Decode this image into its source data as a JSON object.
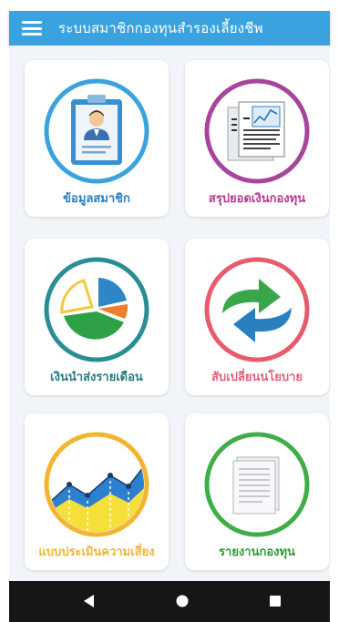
{
  "app": {
    "title": "ระบบสมาชิกกองทุนสำรองเลี้ยงชีพ",
    "accent": "#3aa3df",
    "background": "#f1f4f8"
  },
  "menu": [
    {
      "label": "ข้อมูลสมาชิก",
      "icon": "member-info-icon",
      "color": "#2b7fc4",
      "ring": "#3aa3df"
    },
    {
      "label": "สรุปยอดเงินกองทุน",
      "icon": "fund-summary-icon",
      "color": "#b53a8e",
      "ring": "#a8459a"
    },
    {
      "label": "เงินนำส่งรายเดือน",
      "icon": "monthly-contribution-icon",
      "color": "#2a7c83",
      "ring": "#2a8d94"
    },
    {
      "label": "สับเปลี่ยนนโยบาย",
      "icon": "switch-policy-icon",
      "color": "#e8607a",
      "ring": "#e85b6b"
    },
    {
      "label": "แบบประเมินความเสี่ยง",
      "icon": "risk-assessment-icon",
      "color": "#f2b530",
      "ring": "#f2b530"
    },
    {
      "label": "รายงานกองทุน",
      "icon": "fund-report-icon",
      "color": "#2f9a3c",
      "ring": "#3fae48"
    }
  ],
  "nav": {
    "back": "back-icon",
    "home": "home-icon",
    "recent": "recent-apps-icon"
  }
}
